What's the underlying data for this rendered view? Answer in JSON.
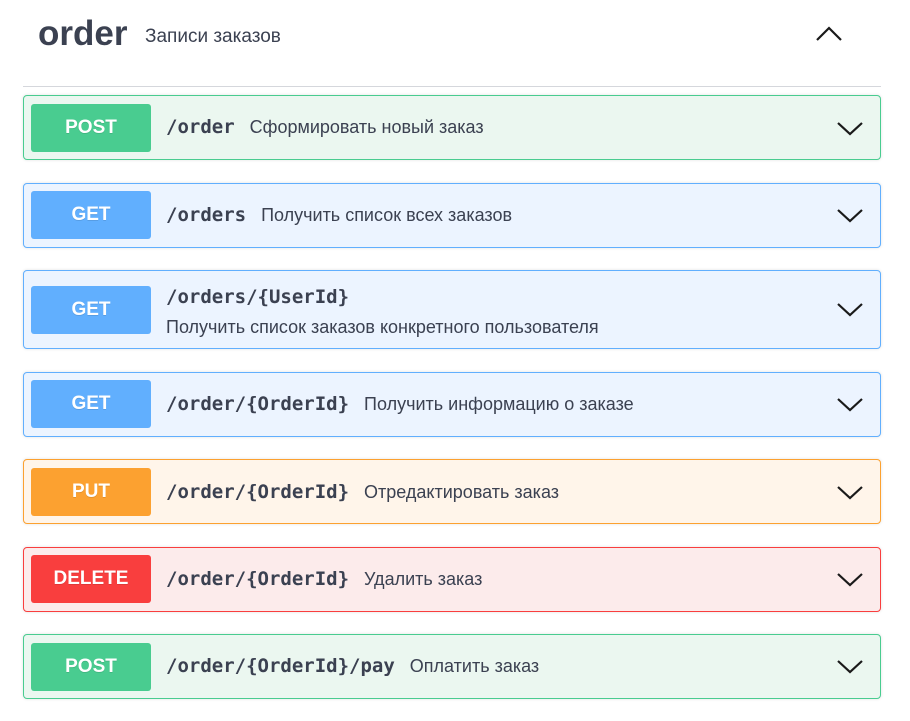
{
  "tag": {
    "name": "order",
    "description": "Записи заказов"
  },
  "operations": [
    {
      "method": "POST",
      "path": "/order",
      "summary": "Сформировать новый заказ"
    },
    {
      "method": "GET",
      "path": "/orders",
      "summary": "Получить список всех заказов"
    },
    {
      "method": "GET",
      "path": "/orders/{UserId}",
      "summary": "Получить список заказов конкретного пользователя"
    },
    {
      "method": "GET",
      "path": "/order/{OrderId}",
      "summary": "Получить информацию о заказе"
    },
    {
      "method": "PUT",
      "path": "/order/{OrderId}",
      "summary": "Отредактировать заказ"
    },
    {
      "method": "DELETE",
      "path": "/order/{OrderId}",
      "summary": "Удалить заказ"
    },
    {
      "method": "POST",
      "path": "/order/{OrderId}/pay",
      "summary": "Оплатить заказ"
    }
  ],
  "icons": {
    "tag_toggle": "chevron-up-icon",
    "operation_toggle": "chevron-down-icon"
  },
  "colors": {
    "post": "#49cc90",
    "get": "#61affe",
    "put": "#fca130",
    "delete": "#f93e3e",
    "text": "#3b4151"
  }
}
